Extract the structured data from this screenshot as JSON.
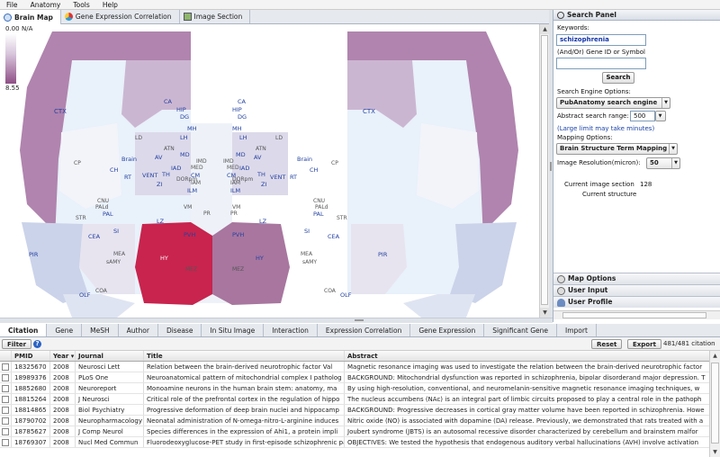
{
  "menu": [
    "File",
    "Anatomy",
    "Tools",
    "Help"
  ],
  "top_tabs": [
    {
      "label": "Brain Map",
      "icon": "brain-map-icon",
      "active": true
    },
    {
      "label": "Gene Expression Correlation",
      "icon": "gene-correlation-icon"
    },
    {
      "label": "Image Section",
      "icon": "image-section-icon"
    }
  ],
  "legend": {
    "min": "0.00",
    "na": "N/A",
    "max": "8.55"
  },
  "map_colors": {
    "high": "#c8244e",
    "mid": "#a8769f",
    "low": "#e7e4f0",
    "outer": "#b084ae"
  },
  "regions": [
    {
      "label": "CA"
    },
    {
      "label": "HIP"
    },
    {
      "label": "DG"
    },
    {
      "label": "MH"
    },
    {
      "label": "LH"
    },
    {
      "label": "LD"
    },
    {
      "label": "ATN"
    },
    {
      "label": "MD"
    },
    {
      "label": "AV"
    },
    {
      "label": "IMD"
    },
    {
      "label": "MED"
    },
    {
      "label": "IAD"
    },
    {
      "label": "Brain"
    },
    {
      "label": "TH"
    },
    {
      "label": "CM"
    },
    {
      "label": "DORpm"
    },
    {
      "label": "IAM"
    },
    {
      "label": "CH"
    },
    {
      "label": "RT"
    },
    {
      "label": "VENT"
    },
    {
      "label": "ZI"
    },
    {
      "label": "ILM"
    },
    {
      "label": "CTX"
    },
    {
      "label": "CP"
    },
    {
      "label": "CNU"
    },
    {
      "label": "PALd"
    },
    {
      "label": "PAL"
    },
    {
      "label": "VM"
    },
    {
      "label": "PR"
    },
    {
      "label": "STR"
    },
    {
      "label": "LZ"
    },
    {
      "label": "PVH"
    },
    {
      "label": "SI"
    },
    {
      "label": "CEA"
    },
    {
      "label": "MEA"
    },
    {
      "label": "sAMY"
    },
    {
      "label": "HY"
    },
    {
      "label": "MEZ"
    },
    {
      "label": "PIR"
    },
    {
      "label": "OLF"
    },
    {
      "label": "COA"
    }
  ],
  "search_panel": {
    "title": "Search Panel",
    "keywords_label": "Keywords:",
    "keywords_value": "schizophrenia",
    "gene_label": "(And/Or) Gene ID or Symbol",
    "gene_value": "",
    "search_button": "Search",
    "engine_label": "Search Engine Options:",
    "engine_value": "PubAnatomy search engine",
    "abstract_range_label": "Abstract search range:",
    "abstract_range_value": "500",
    "large_limit_note": "(Large limit may take minutes)",
    "mapping_label": "Mapping Options:",
    "mapping_value": "Brain Structure Term Mapping",
    "resolution_label": "Image Resolution(micron):",
    "resolution_value": "50",
    "current_section_label": "Current image section",
    "current_section_value": "128",
    "current_structure_label": "Current structure"
  },
  "accordions": [
    {
      "label": "Map Options",
      "icon": "map-options-icon"
    },
    {
      "label": "User Input",
      "icon": "user-input-icon"
    },
    {
      "label": "User Profile",
      "icon": "user-profile-icon"
    }
  ],
  "bottom_tabs": [
    "Citation",
    "Gene",
    "MeSH",
    "Author",
    "Disease",
    "In Situ Image",
    "Interaction",
    "Expression Correlation",
    "Gene Expression",
    "Significant Gene",
    "Import"
  ],
  "filter": {
    "filter_button": "Filter",
    "reset_button": "Reset",
    "export_button": "Export",
    "count": "481/481 citation"
  },
  "table": {
    "columns": [
      "PMID",
      "Year ▾",
      "Journal",
      "Title",
      "Abstract"
    ],
    "rows": [
      [
        "18325670",
        "2008",
        "Neurosci Lett",
        "Relation between the brain-derived neurotrophic factor Val",
        "Magnetic resonance imaging was used to investigate the relation between the brain-derived neurotrophic factor"
      ],
      [
        "18989376",
        "2008",
        "PLoS One",
        "Neuroanatomical pattern of mitochondrial complex I patholog",
        "BACKGROUND: Mitochondrial dysfunction was reported in schizophrenia, bipolar disorderand major depression. T"
      ],
      [
        "18852680",
        "2008",
        "Neuroreport",
        "Monoamine neurons in the human brain stem: anatomy, ma",
        "By using high-resolution, conventional, and neuromelanin-sensitive magnetic resonance imaging techniques, w"
      ],
      [
        "18815264",
        "2008",
        "J Neurosci",
        "Critical role of the prefrontal cortex in the regulation of hippo",
        "The nucleus accumbens (NAc) is an integral part of limbic circuits proposed to play a central role in the pathoph"
      ],
      [
        "18814865",
        "2008",
        "Biol Psychiatry",
        "Progressive deformation of deep brain nuclei and hippocamp",
        "BACKGROUND: Progressive decreases in cortical gray matter volume have been reported in schizophrenia. Howe"
      ],
      [
        "18790702",
        "2008",
        "Neuropharmacology",
        "Neonatal administration of N-omega-nitro-L-arginine induces",
        "Nitric oxide (NO) is associated with dopamine (DA) release. Previously, we demonstrated that rats treated with a"
      ],
      [
        "18785627",
        "2008",
        "J Comp Neurol",
        "Species differences in the expression of Ahi1, a protein impli",
        "Joubert syndrome (JBTS) is an autosomal recessive disorder characterized by cerebellum and brainstem malfor"
      ],
      [
        "18769307",
        "2008",
        "Nucl Med Commun",
        "Fluorodeoxyglucose-PET study in first-episode schizophrenic pa",
        "OBJECTIVES: We tested the hypothesis that endogenous auditory verbal hallucinations (AVH) involve activation"
      ]
    ]
  }
}
